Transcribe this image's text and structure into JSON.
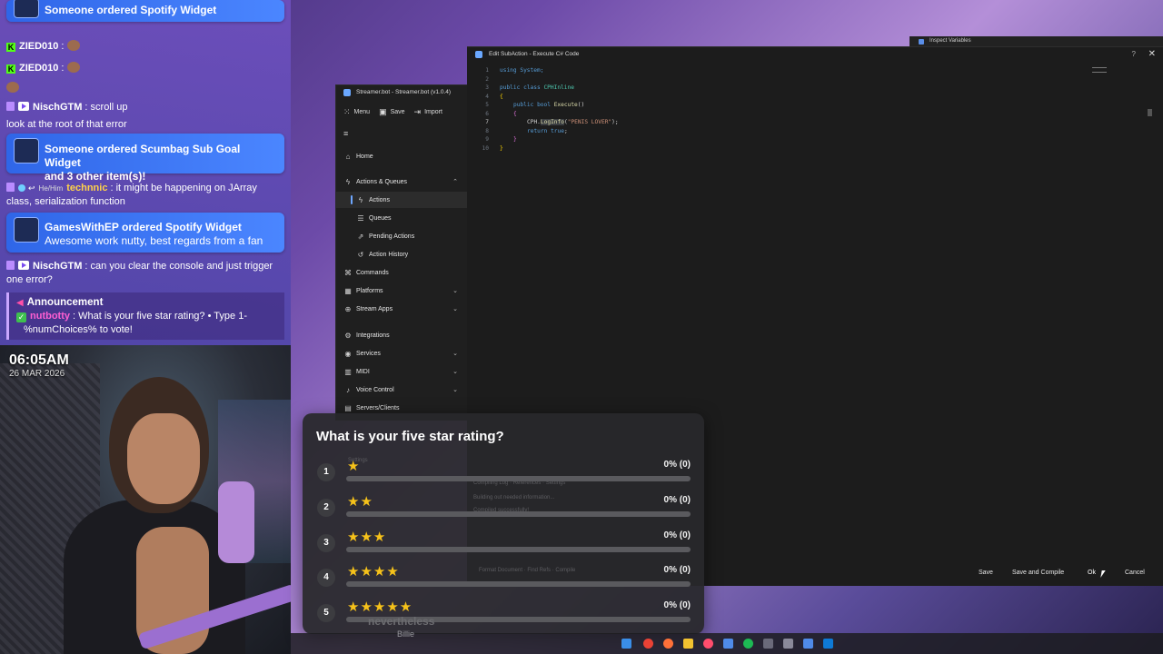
{
  "chat": {
    "lines": [
      {
        "type": "order",
        "text": "Someone ordered Spotify Widget",
        "sub": ""
      },
      {
        "type": "msg",
        "user": "ZIED010",
        "message": ""
      },
      {
        "type": "msg",
        "user": "ZIED010",
        "message": ""
      },
      {
        "type": "msg",
        "user": "NischGTM",
        "message": "scroll up"
      },
      {
        "type": "text",
        "message": "look at the root of that error"
      },
      {
        "type": "order",
        "text": "Someone ordered Scumbag Sub Goal Widget",
        "sub": "and 3 other item(s)!"
      },
      {
        "type": "msg",
        "user": "technnic",
        "pronoun": "He/Him",
        "message": "it might be happening on JArray",
        "cont": "class, serialization function"
      },
      {
        "type": "order",
        "text": "GamesWithEP ordered Spotify Widget",
        "sub": "Awesome work nutty, best regards from a fan"
      },
      {
        "type": "msg",
        "user": "NischGTM",
        "message": "can you clear the console and just trigger",
        "cont": "one error?"
      }
    ],
    "announcement": {
      "title": "Announcement",
      "user": "nutbotty",
      "message": "What is your five star rating? • Type 1-",
      "cont": "%numChoices% to vote!"
    }
  },
  "webcam": {
    "time": "06:05AM",
    "date": "26 MAR 2026"
  },
  "streamerbot": {
    "title": "Streamer.bot - Streamer.bot (v1.0.4)",
    "toolbar": {
      "menu": "Menu",
      "save": "Save",
      "import": "Import"
    },
    "nav": {
      "home": "Home",
      "actions_queues": "Actions & Queues",
      "actions": "Actions",
      "queues": "Queues",
      "pending": "Pending Actions",
      "history": "Action History",
      "commands": "Commands",
      "platforms": "Platforms",
      "stream_apps": "Stream Apps",
      "integrations": "Integrations",
      "services": "Services",
      "midi": "MIDI",
      "voice": "Voice Control",
      "servers": "Servers/Clients"
    }
  },
  "editor": {
    "title": "Edit SubAction - Execute C# Code",
    "code": {
      "l1": "using System;",
      "l3a": "public class ",
      "l3b": "CPHInline",
      "l4": "{",
      "l5a": "public bool ",
      "l5b": "Execute",
      "l5c": "()",
      "l6": "{",
      "l7a": "CPH.",
      "l7b": "LogInfo",
      "l7c": "(",
      "l7d": "\"PENIS LOVER\"",
      "l7e": ");",
      "l8a": "return ",
      "l8b": "true",
      "l8c": ";",
      "l9": "}",
      "l10": "}"
    },
    "buttons": {
      "save": "Save",
      "save_compile": "Save and Compile",
      "ok": "Ok",
      "cancel": "Cancel"
    }
  },
  "inspect": {
    "title": "Inspect Variables"
  },
  "poll": {
    "question": "What is your five star rating?",
    "options": [
      {
        "num": "1",
        "stars": "★",
        "pct": "0% (0)",
        "fraction": 0
      },
      {
        "num": "2",
        "stars": "★★",
        "pct": "0% (0)",
        "fraction": 0
      },
      {
        "num": "3",
        "stars": "★★★",
        "pct": "0% (0)",
        "fraction": 0
      },
      {
        "num": "4",
        "stars": "★★★★",
        "pct": "0% (0)",
        "fraction": 0
      },
      {
        "num": "5",
        "stars": "★★★★★",
        "pct": "0% (0)",
        "fraction": 0
      }
    ]
  },
  "caption": {
    "line1": "nevertheless",
    "line2": "Billie"
  },
  "colors": {
    "accent": "#f6c21a",
    "order_card": "#3b78f5",
    "chat_bg": "#6d4fc0"
  }
}
